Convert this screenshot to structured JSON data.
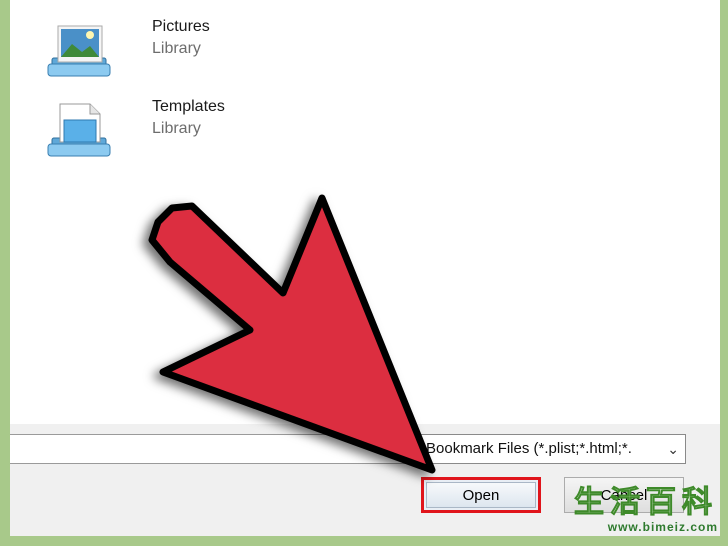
{
  "libraries": [
    {
      "name": "Pictures",
      "type": "Library"
    },
    {
      "name": "Templates",
      "type": "Library"
    }
  ],
  "file_type_filter": {
    "selected": "Bookmark Files (*.plist;*.html;*."
  },
  "buttons": {
    "open": "Open",
    "cancel": "Cancel"
  },
  "overlay": {
    "arrow_color": "#dc2f3f",
    "highlight_color": "#e0141b"
  },
  "watermark": {
    "chars": "生活百科",
    "url": "www.bimeiz.com"
  },
  "icons": {
    "library": "library-icon",
    "dropdown": "chevron-down-icon"
  }
}
